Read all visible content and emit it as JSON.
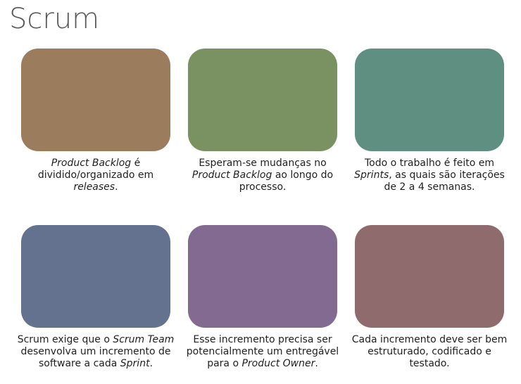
{
  "title": "Scrum",
  "cards": [
    {
      "color": "#9b7d5e",
      "caption": [
        {
          "text": "Product Backlog",
          "italic": true
        },
        {
          "text": " é dividido/organizado em ",
          "italic": false
        },
        {
          "text": "releases",
          "italic": true
        },
        {
          "text": ".",
          "italic": false
        }
      ]
    },
    {
      "color": "#7a9262",
      "caption": [
        {
          "text": "Esperam-se mudanças no ",
          "italic": false
        },
        {
          "text": "Product Backlog",
          "italic": true
        },
        {
          "text": " ao longo do processo.",
          "italic": false
        }
      ]
    },
    {
      "color": "#5f8f80",
      "caption": [
        {
          "text": "Todo o trabalho é feito em ",
          "italic": false
        },
        {
          "text": "Sprints",
          "italic": true
        },
        {
          "text": ", as quais são iterações de 2 a 4 semanas.",
          "italic": false
        }
      ]
    },
    {
      "color": "#64728f",
      "caption": [
        {
          "text": "Scrum exige que o ",
          "italic": false
        },
        {
          "text": "Scrum Team",
          "italic": true
        },
        {
          "text": " desenvolva um incremento de software a cada ",
          "italic": false
        },
        {
          "text": "Sprint",
          "italic": true
        },
        {
          "text": ".",
          "italic": false
        }
      ]
    },
    {
      "color": "#826a91",
      "caption": [
        {
          "text": "Esse incremento precisa ser potencialmente um entregável para o ",
          "italic": false
        },
        {
          "text": "Product Owner",
          "italic": true
        },
        {
          "text": ".",
          "italic": false
        }
      ]
    },
    {
      "color": "#8f6b6e",
      "caption": [
        {
          "text": "Cada incremento deve ser bem estruturado, codificado e testado.",
          "italic": false
        }
      ]
    }
  ]
}
